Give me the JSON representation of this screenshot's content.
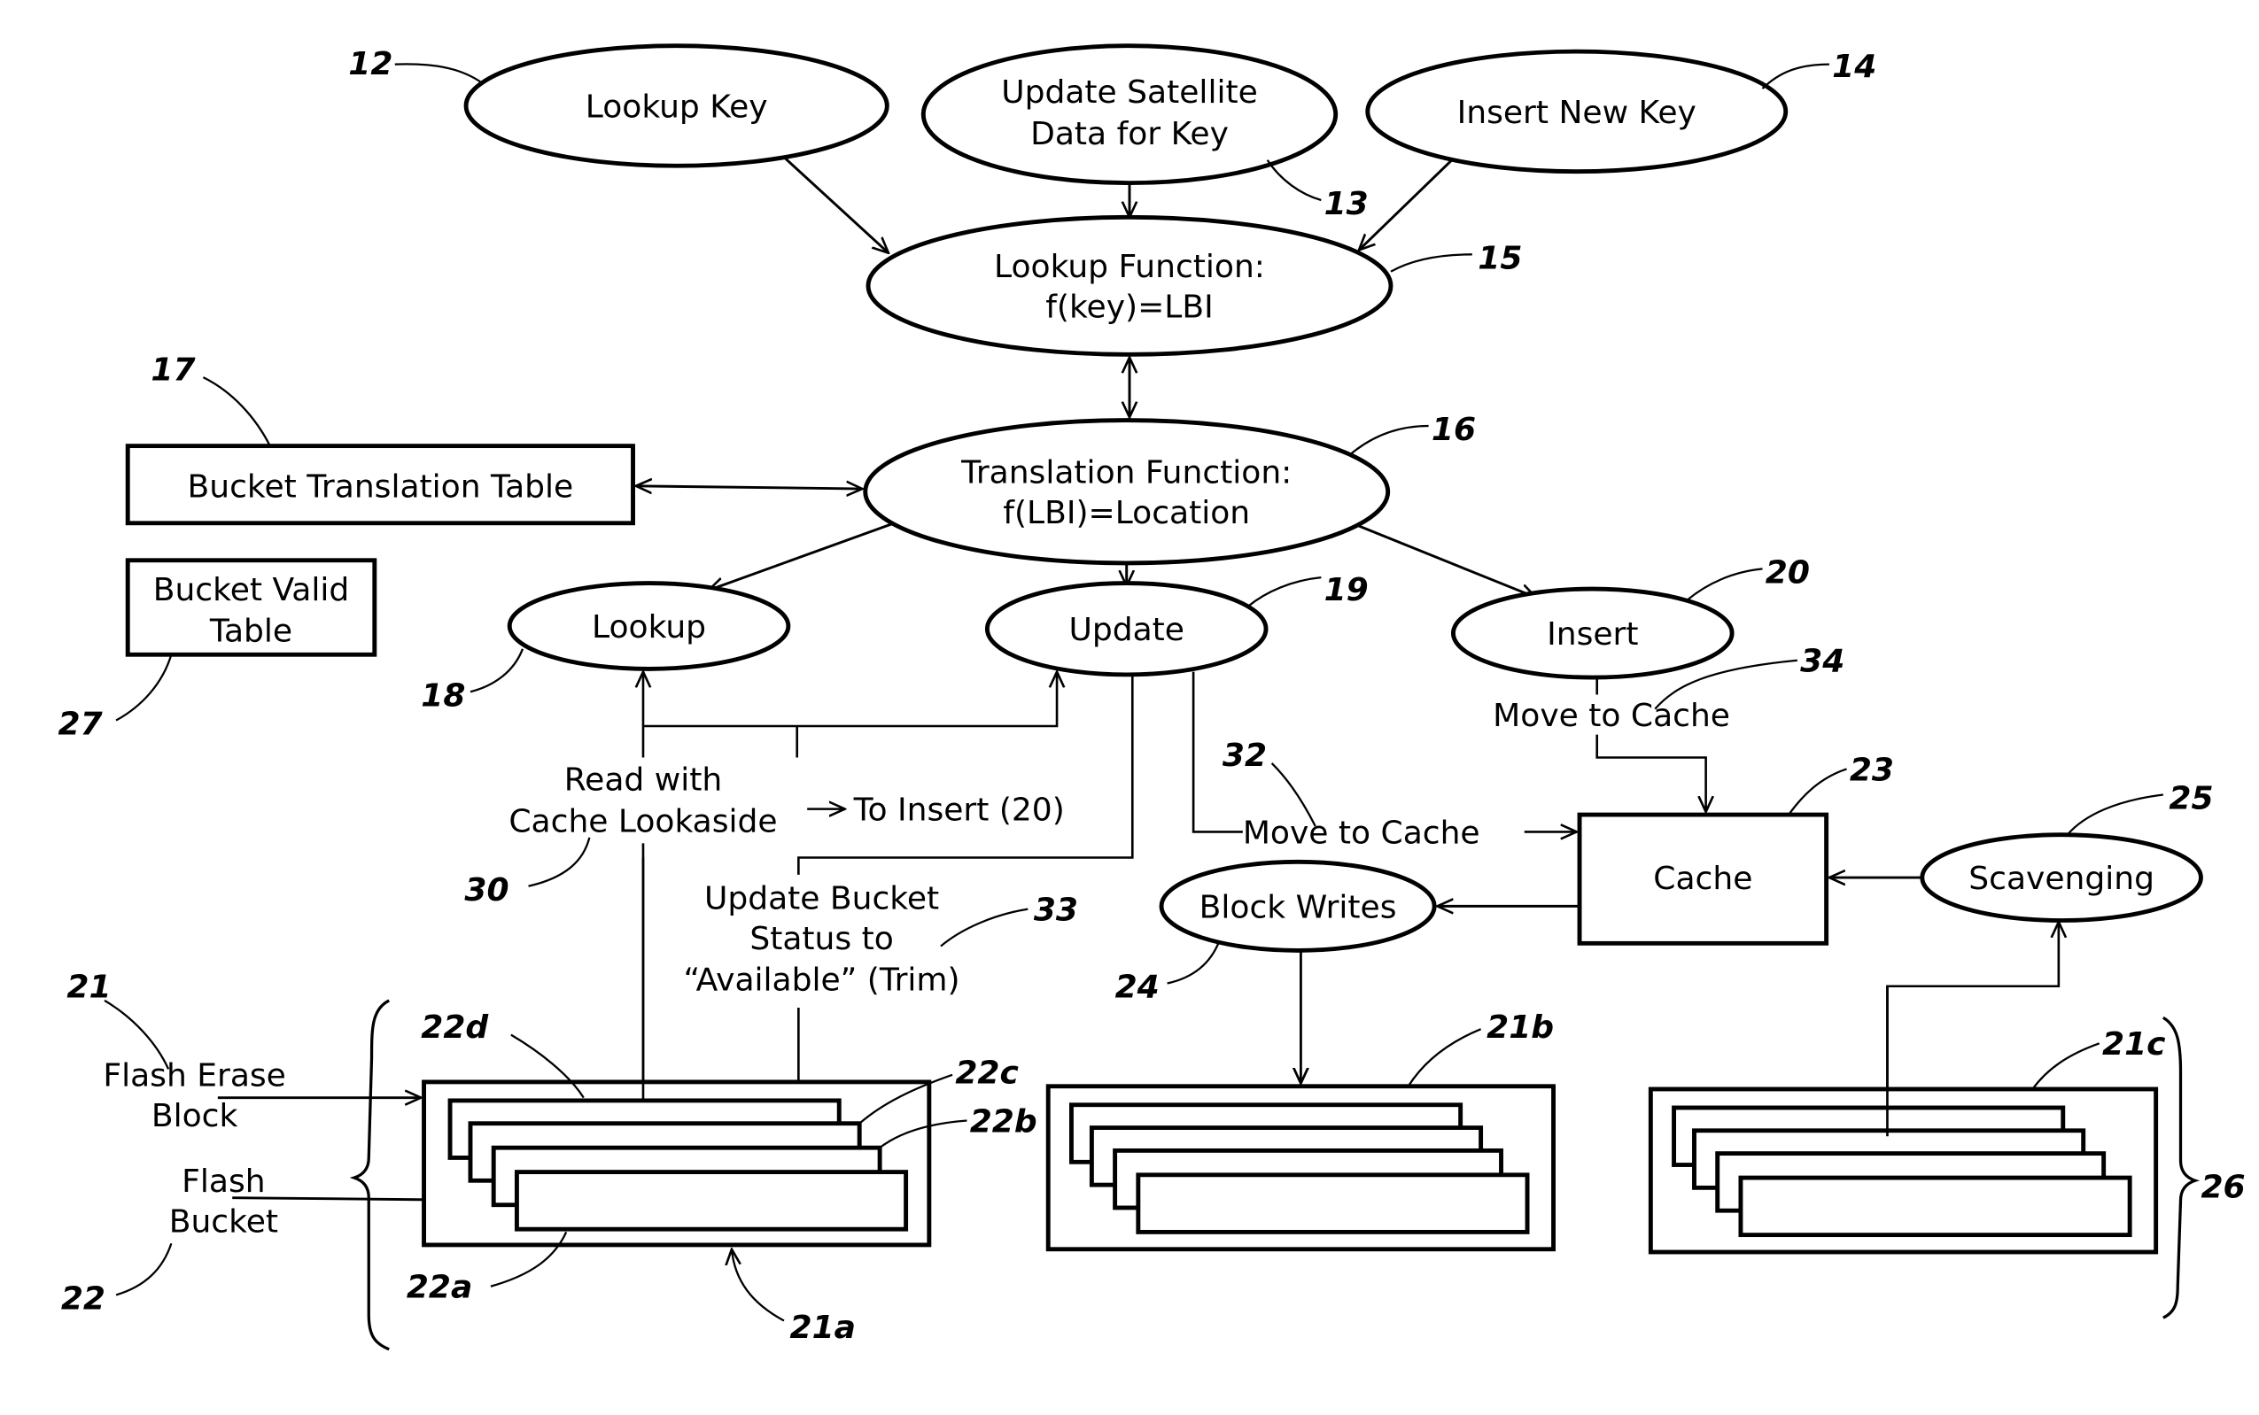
{
  "figure": {
    "nodes": {
      "lookup_key": {
        "label": "Lookup Key",
        "ref": "12"
      },
      "update_satellite": {
        "label_line1": "Update Satellite",
        "label_line2": "Data for Key",
        "ref": "13"
      },
      "insert_new_key": {
        "label": "Insert New Key",
        "ref": "14"
      },
      "lookup_function": {
        "label_line1": "Lookup Function:",
        "label_line2": "f(key)=LBI",
        "ref": "15"
      },
      "translation_function": {
        "label_line1": "Translation Function:",
        "label_line2": "f(LBI)=Location",
        "ref": "16"
      },
      "bucket_translation_table": {
        "label": "Bucket Translation Table",
        "ref": "17"
      },
      "bucket_valid_table": {
        "label_line1": "Bucket Valid",
        "label_line2": "Table",
        "ref": "27"
      },
      "lookup": {
        "label": "Lookup",
        "ref": "18"
      },
      "update": {
        "label": "Update",
        "ref": "19"
      },
      "insert": {
        "label": "Insert",
        "ref": "20"
      },
      "cache": {
        "label": "Cache",
        "ref": "23"
      },
      "block_writes": {
        "label": "Block Writes",
        "ref": "24"
      },
      "scavenging": {
        "label": "Scavenging",
        "ref": "25"
      }
    },
    "annotations": {
      "read_with_cache": {
        "line1": "Read with",
        "line2": "Cache Lookaside",
        "ref": "30"
      },
      "to_insert": {
        "label": "To Insert (20)"
      },
      "move_to_cache_update": {
        "label": "Move to Cache",
        "ref": "32"
      },
      "update_bucket_status": {
        "line1": "Update Bucket",
        "line2": "Status to",
        "line3": "“Available” (Trim)",
        "ref": "33"
      },
      "move_to_cache_insert": {
        "label": "Move to Cache",
        "ref": "34"
      },
      "flash_erase_block": {
        "line1": "Flash Erase",
        "line2": "Block",
        "ref": "21"
      },
      "flash_bucket": {
        "line1": "Flash",
        "line2": "Bucket",
        "ref": "22"
      }
    },
    "blocks": {
      "block_a": {
        "ref": "21a",
        "buckets": [
          "22a",
          "22b",
          "22c",
          "22d"
        ]
      },
      "block_b": {
        "ref": "21b"
      },
      "block_c": {
        "ref": "21c"
      },
      "group_ref": "26"
    }
  }
}
